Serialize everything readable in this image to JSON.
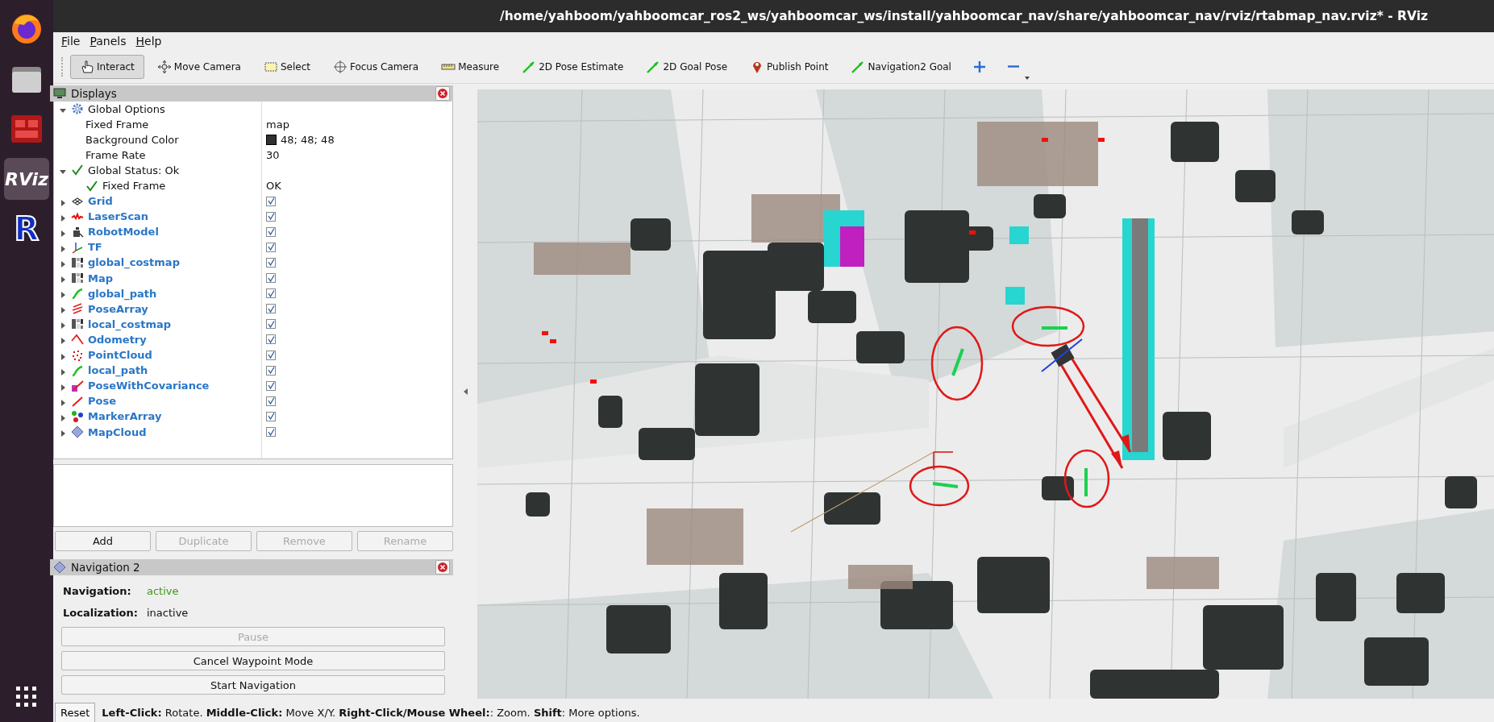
{
  "window": {
    "title": "/home/yahboom/yahboomcar_ros2_ws/yahboomcar_ws/install/yahboomcar_nav/share/yahboomcar_nav/rviz/rtabmap_nav.rviz* - RViz"
  },
  "dock": {
    "items": [
      {
        "kind": "browser",
        "selected": false
      },
      {
        "kind": "files",
        "selected": false
      },
      {
        "kind": "app",
        "selected": false
      },
      {
        "kind": "logo",
        "label": "RViz",
        "selected": true
      },
      {
        "kind": "letter",
        "label": "R",
        "selected": false
      }
    ]
  },
  "menu": [
    "File",
    "Panels",
    "Help"
  ],
  "toolbar": {
    "tools": [
      {
        "kind": "hand",
        "label": "Interact",
        "selected": true
      },
      {
        "kind": "move",
        "label": "Move Camera",
        "selected": false
      },
      {
        "kind": "select",
        "label": "Select",
        "selected": false
      },
      {
        "kind": "focus",
        "label": "Focus Camera",
        "selected": false
      },
      {
        "kind": "measure",
        "label": "Measure",
        "selected": false
      },
      {
        "kind": "arrow",
        "label": "2D Pose Estimate",
        "selected": false
      },
      {
        "kind": "arrow",
        "label": "2D Goal Pose",
        "selected": false
      },
      {
        "kind": "pin",
        "label": "Publish Point",
        "selected": false
      },
      {
        "kind": "arrow",
        "label": "Navigation2 Goal",
        "selected": false
      },
      {
        "kind": "plus",
        "selected": false
      },
      {
        "kind": "minus",
        "selected": false
      }
    ]
  },
  "displays": {
    "title": "Displays",
    "tree": [
      {
        "kind": "gear",
        "label": "Global Options",
        "expanded": true,
        "children": [
          {
            "label": "Fixed Frame",
            "value": "map"
          },
          {
            "label": "Background Color",
            "value": "48; 48; 48",
            "color": "#303030"
          },
          {
            "label": "Frame Rate",
            "value": "30"
          }
        ]
      },
      {
        "kind": "status",
        "label": "Global Status: Ok",
        "expanded": true,
        "children": [
          {
            "kind": "status",
            "label": "Fixed Frame",
            "value": "OK"
          }
        ]
      },
      {
        "kind": "grid",
        "label": "Grid",
        "expanded": false,
        "checked": true
      },
      {
        "kind": "laser",
        "label": "LaserScan",
        "expanded": false,
        "checked": true
      },
      {
        "kind": "robot",
        "label": "RobotModel",
        "expanded": false,
        "checked": true
      },
      {
        "kind": "axes",
        "label": "TF",
        "expanded": false,
        "checked": true
      },
      {
        "kind": "costmap",
        "label": "global_costmap",
        "expanded": false,
        "checked": true
      },
      {
        "kind": "costmap",
        "label": "Map",
        "expanded": false,
        "checked": true
      },
      {
        "kind": "path",
        "label": "global_path",
        "expanded": false,
        "checked": true
      },
      {
        "kind": "posearray",
        "label": "PoseArray",
        "expanded": false,
        "checked": true
      },
      {
        "kind": "costmap",
        "label": "local_costmap",
        "expanded": false,
        "checked": true
      },
      {
        "kind": "odometry",
        "label": "Odometry",
        "expanded": false,
        "checked": true
      },
      {
        "kind": "pointcloud",
        "label": "PointCloud",
        "expanded": false,
        "checked": true
      },
      {
        "kind": "path",
        "label": "local_path",
        "expanded": false,
        "checked": true
      },
      {
        "kind": "posecov",
        "label": "PoseWithCovariance",
        "expanded": false,
        "checked": true
      },
      {
        "kind": "pose",
        "label": "Pose",
        "expanded": false,
        "checked": true
      },
      {
        "kind": "markers",
        "label": "MarkerArray",
        "expanded": false,
        "checked": true
      },
      {
        "kind": "diamond",
        "label": "MapCloud",
        "expanded": false,
        "checked": true
      }
    ],
    "buttons": [
      {
        "label": "Add",
        "disabled": false
      },
      {
        "label": "Duplicate",
        "disabled": true
      },
      {
        "label": "Remove",
        "disabled": true
      },
      {
        "label": "Rename",
        "disabled": true
      }
    ]
  },
  "navigation": {
    "title": "Navigation 2",
    "fields": [
      {
        "label": "Navigation:",
        "value": "active",
        "color": "#3b9a1a"
      },
      {
        "label": "Localization:",
        "value": "inactive",
        "color": "#111111"
      }
    ],
    "buttons": [
      {
        "label": "Pause",
        "disabled": true
      },
      {
        "label": "Cancel Waypoint Mode",
        "disabled": false
      },
      {
        "label": "Start Navigation",
        "disabled": false
      }
    ]
  },
  "status_bar": {
    "reset": "Reset",
    "hint": "**Left-Click:** Rotate. **Middle-Click:** Move X/Y. **Right-Click/Mouse Wheel:**: Zoom. **Shift**: More options."
  }
}
